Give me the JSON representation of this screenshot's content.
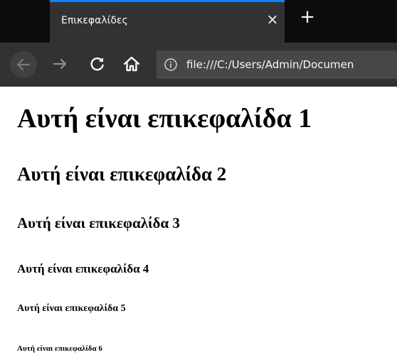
{
  "browser": {
    "tab": {
      "title": "Επικεφαλίδες",
      "close_glyph": "×"
    },
    "new_tab_glyph": "+",
    "nav": {
      "back_icon": "arrow-left-icon",
      "forward_icon": "arrow-right-icon",
      "reload_icon": "reload-icon",
      "home_icon": "home-icon",
      "site_info_icon": "info-icon"
    },
    "url": "file:///C:/Users/Admin/Documen",
    "colors": {
      "tabstrip_bg": "#0c0c0d",
      "toolbar_bg": "#323234",
      "active_tab_accent": "#0a84ff",
      "urlbar_bg": "#474749",
      "toolbar_text": "#f9f9fa"
    }
  },
  "page": {
    "headings": [
      "Αυτή είναι επικεφαλίδα 1",
      "Αυτή είναι επικεφαλίδα 2",
      "Αυτή είναι επικεφαλίδα 3",
      "Αυτή είναι επικεφαλίδα 4",
      "Αυτή είναι επικεφαλίδα 5",
      "Αυτή είναι επικεφαλίδα 6"
    ]
  }
}
